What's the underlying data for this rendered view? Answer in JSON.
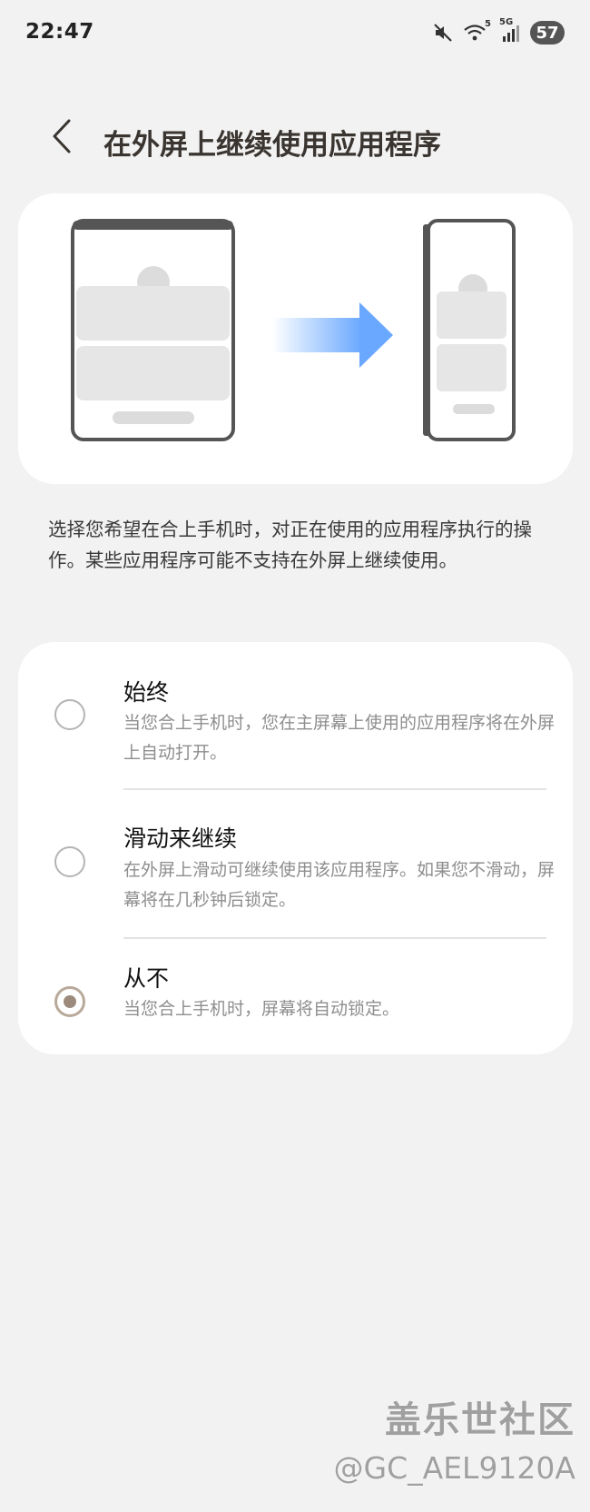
{
  "status_bar": {
    "time": "22:47",
    "signal_label": "5G",
    "wifi_label": "5",
    "battery": "57",
    "icons": [
      "mute-icon",
      "wifi-icon",
      "signal-icon",
      "battery-icon"
    ]
  },
  "header": {
    "back_icon": "chevron-left-icon",
    "title": "在外屏上继续使用应用程序"
  },
  "description": "选择您希望在合上手机时，对正在使用的应用程序执行的操作。某些应用程序可能不支持在外屏上继续使用。",
  "options": [
    {
      "title": "始终",
      "description": "当您合上手机时，您在主屏幕上使用的应用程序将在外屏上自动打开。",
      "selected": false
    },
    {
      "title": "滑动来继续",
      "description": "在外屏上滑动可继续使用该应用程序。如果您不滑动，屏幕将在几秒钟后锁定。",
      "selected": false
    },
    {
      "title": "从不",
      "description": "当您合上手机时，屏幕将自动锁定。",
      "selected": true
    }
  ],
  "watermark": {
    "logo": "盖乐世社区",
    "user": "@GC_AEL9120A"
  },
  "colors": {
    "background": "#f2f2f2",
    "card": "#ffffff",
    "title": "#3a3530",
    "radio_selected": "#9c8b7d",
    "arrow": "#6aa8ff"
  }
}
